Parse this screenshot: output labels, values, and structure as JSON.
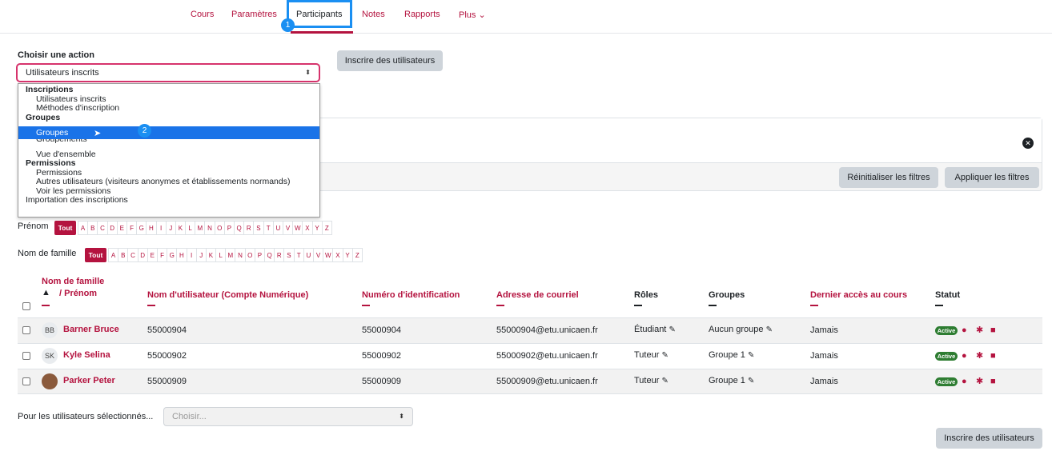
{
  "nav": {
    "items": [
      {
        "label": "Cours"
      },
      {
        "label": "Paramètres"
      },
      {
        "label": "Participants"
      },
      {
        "label": "Notes"
      },
      {
        "label": "Rapports"
      },
      {
        "label": "Plus"
      }
    ],
    "more_caret": "⌄",
    "active": "Participants",
    "annotations": [
      "1",
      "2"
    ]
  },
  "action": {
    "label": "Choisir une action",
    "selected": "Utilisateurs inscrits",
    "enrol_button": "Inscrire des utilisateurs",
    "dropdown": [
      {
        "type": "group",
        "label": "Inscriptions"
      },
      {
        "type": "option",
        "label": "Utilisateurs inscrits"
      },
      {
        "type": "option",
        "label": "Méthodes d'inscription"
      },
      {
        "type": "group",
        "label": "Groupes"
      },
      {
        "type": "option",
        "label": "Groupes",
        "highlighted": true
      },
      {
        "type": "option",
        "label": "Groupements"
      },
      {
        "type": "option",
        "label": "Vue d'ensemble"
      },
      {
        "type": "group",
        "label": "Permissions"
      },
      {
        "type": "option",
        "label": "Permissions"
      },
      {
        "type": "option",
        "label": "Autres utilisateurs (visiteurs anonymes et établissements normands)"
      },
      {
        "type": "option",
        "label": "Voir les permissions"
      },
      {
        "type": "group-plain",
        "label": "Importation des inscriptions"
      }
    ]
  },
  "filters": {
    "reset_button": "Réinitialiser les filtres",
    "apply_button": "Appliquer les filtres",
    "close_glyph": "✕"
  },
  "initials": {
    "firstname_label": "Prénom",
    "lastname_label": "Nom de famille",
    "all_label": "Tout",
    "letters": [
      "A",
      "B",
      "C",
      "D",
      "E",
      "F",
      "G",
      "H",
      "I",
      "J",
      "K",
      "L",
      "M",
      "N",
      "O",
      "P",
      "Q",
      "R",
      "S",
      "T",
      "U",
      "V",
      "W",
      "X",
      "Y",
      "Z"
    ]
  },
  "table": {
    "headers": {
      "name_line1": "Nom de famille",
      "name_line2": "/ Prénom",
      "sort_arrow": "▲",
      "username": "Nom d'utilisateur (Compte Numérique)",
      "idnumber": "Numéro d'identification",
      "email": "Adresse de courriel",
      "roles": "Rôles",
      "groups": "Groupes",
      "lastaccess": "Dernier accès au cours",
      "status": "Statut"
    },
    "rows": [
      {
        "initials": "BB",
        "name": "Barner Bruce",
        "username": "55000904",
        "idnumber": "55000904",
        "email": "55000904@etu.unicaen.fr",
        "role": "Étudiant",
        "group": "Aucun groupe",
        "lastaccess": "Jamais",
        "status": "Active"
      },
      {
        "initials": "SK",
        "name": "Kyle Selina",
        "username": "55000902",
        "idnumber": "55000902",
        "email": "55000902@etu.unicaen.fr",
        "role": "Tuteur",
        "group": "Groupe 1",
        "lastaccess": "Jamais",
        "status": "Active"
      },
      {
        "initials": "",
        "name": "Parker Peter",
        "username": "55000909",
        "idnumber": "55000909",
        "email": "55000909@etu.unicaen.fr",
        "role": "Tuteur",
        "group": "Groupe 1",
        "lastaccess": "Jamais",
        "status": "Active"
      }
    ]
  },
  "bulk": {
    "label": "Pour les utilisateurs sélectionnés...",
    "placeholder": "Choisir...",
    "enrol_button": "Inscrire des utilisateurs"
  },
  "colors": {
    "accent": "#b4133f",
    "annotation": "#1a8ff2",
    "selection": "#1a73e8",
    "active": "#2e7d32"
  }
}
